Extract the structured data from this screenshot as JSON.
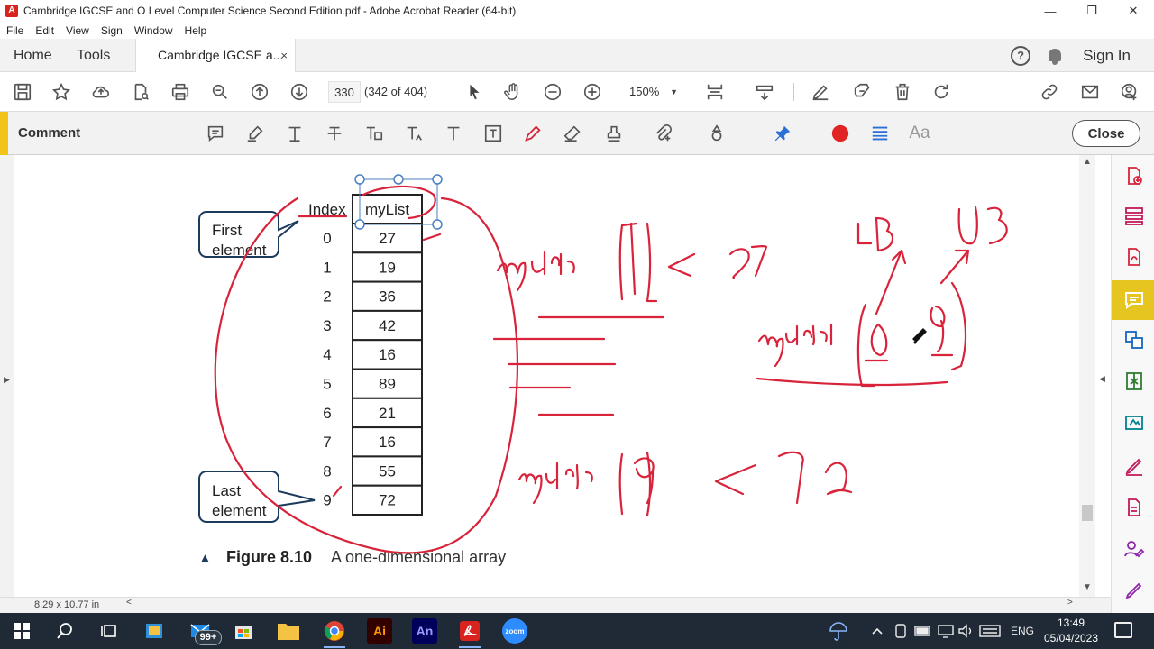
{
  "window": {
    "title": "Cambridge IGCSE and O Level Computer Science Second Edition.pdf - Adobe Acrobat Reader (64-bit)",
    "app_icon_glyph": "A",
    "minimize": "—",
    "maximize": "❐",
    "close": "✕"
  },
  "menu": [
    "File",
    "Edit",
    "View",
    "Sign",
    "Window",
    "Help"
  ],
  "tabs": {
    "home": "Home",
    "tools": "Tools",
    "document": "Cambridge IGCSE a...",
    "close_glyph": "×",
    "help_glyph": "?",
    "sign_in": "Sign In"
  },
  "toolbar": {
    "current_page": "330",
    "page_count": "(342 of 404)",
    "zoom": "150%",
    "zoom_caret": "▼"
  },
  "comment_bar": {
    "label": "Comment",
    "text_size_label": "Aa",
    "close_label": "Close",
    "colors": {
      "active_color": "#e02424",
      "highlight_line": "#2a6fd6"
    }
  },
  "document": {
    "table_header": {
      "index": "Index",
      "column": "myList"
    },
    "rows": [
      {
        "index": "0",
        "value": "27"
      },
      {
        "index": "1",
        "value": "19"
      },
      {
        "index": "2",
        "value": "36"
      },
      {
        "index": "3",
        "value": "42"
      },
      {
        "index": "4",
        "value": "16"
      },
      {
        "index": "5",
        "value": "89"
      },
      {
        "index": "6",
        "value": "21"
      },
      {
        "index": "7",
        "value": "16"
      },
      {
        "index": "8",
        "value": "55"
      },
      {
        "index": "9",
        "value": "72"
      }
    ],
    "callout_first": [
      "First",
      "element"
    ],
    "callout_last": [
      "Last",
      "element"
    ],
    "figure_marker": "▲",
    "figure_label": "Figure 8.10",
    "figure_caption": "A one-dimensional array",
    "annotation_color": "#d8233a"
  },
  "status": {
    "page_size": "8.29 x 10.77 in",
    "scroll_left": "<",
    "scroll_right": ">"
  },
  "taskbar": {
    "mail_badge": "99+",
    "ai_label": "Ai",
    "an_label": "An",
    "zoom_label": "zoom",
    "language": "ENG",
    "time": "13:49",
    "date": "05/04/2023"
  },
  "icons": {
    "toolbar": [
      "save-icon",
      "star-icon",
      "upload-icon",
      "file-search-icon",
      "print-icon",
      "zoom-search-icon",
      "prev-page-icon",
      "next-page-icon",
      "select-arrow-icon",
      "hand-icon",
      "zoom-out-icon",
      "zoom-in-icon",
      "page-fit-icon",
      "scroll-mode-icon",
      "pen-edit-icon",
      "fill-sign-icon",
      "delete-icon",
      "rotate-icon",
      "link-icon",
      "mail-icon",
      "add-person-icon"
    ],
    "comment": [
      "sticky-note-icon",
      "highlighter-icon",
      "text-icon",
      "strikethrough-icon",
      "replace-text-icon",
      "insert-text-icon",
      "add-text-icon",
      "text-box-icon",
      "pencil-icon",
      "eraser-icon",
      "stamp-icon",
      "attach-icon",
      "shapes-icon",
      "pin-icon",
      "color-dot-icon",
      "line-weight-icon",
      "text-size-icon"
    ],
    "right_panel": [
      "create-pdf-icon",
      "organize-pages-icon",
      "export-pdf-icon",
      "comment-panel-icon",
      "convert-icon",
      "compress-icon",
      "edit-pdf-icon",
      "fill-sign-panel-icon",
      "protect-icon",
      "request-sign-icon",
      "more-tools-icon"
    ]
  }
}
